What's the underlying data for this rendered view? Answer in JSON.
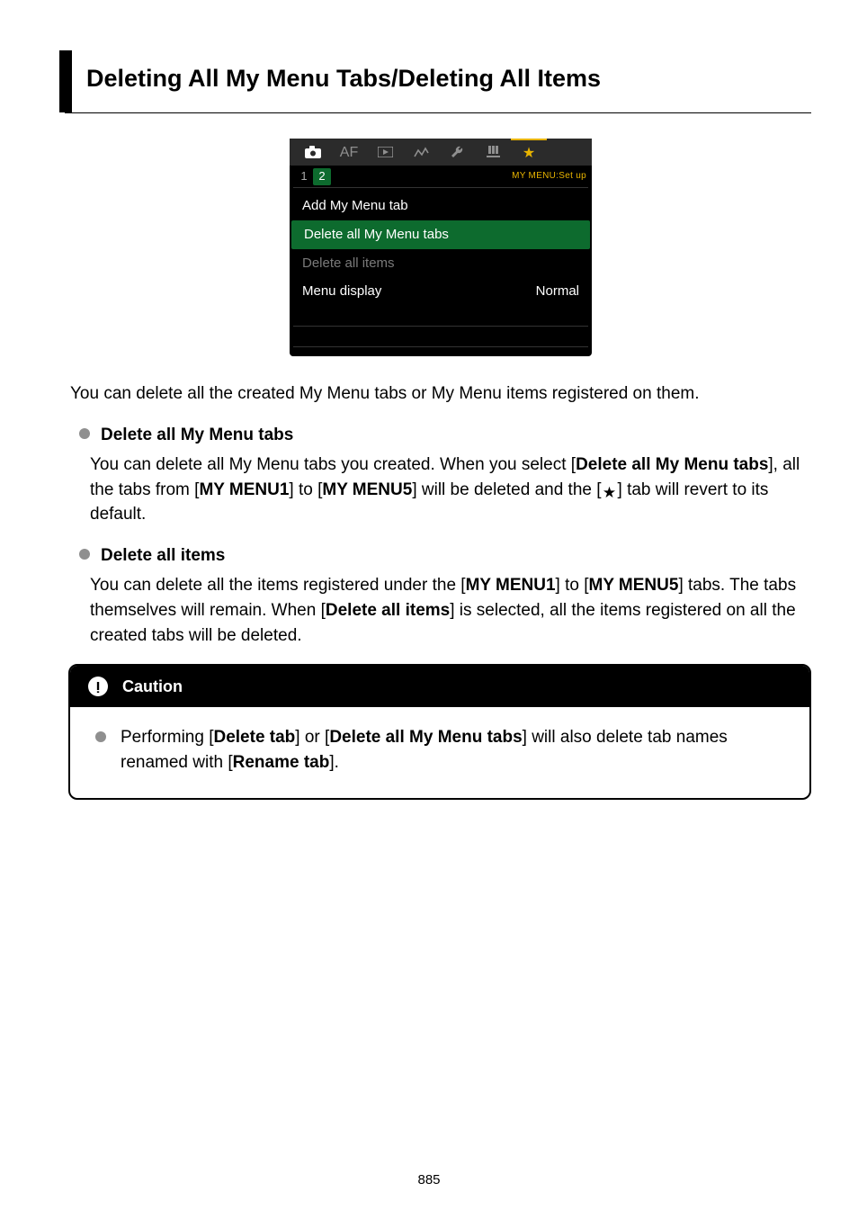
{
  "heading": "Deleting All My Menu Tabs/Deleting All Items",
  "menu": {
    "tabs": {
      "af_label": "AF",
      "sub1": "1",
      "sub2": "2",
      "sub_label": "MY MENU:Set up"
    },
    "items": {
      "add": "Add My Menu tab",
      "delete_tabs": "Delete all My Menu tabs",
      "delete_items": "Delete all items",
      "menu_display_label": "Menu display",
      "menu_display_value": "Normal"
    }
  },
  "intro": "You can delete all the created My Menu tabs or My Menu items registered on them.",
  "sections": {
    "tabs": {
      "title": "Delete all My Menu tabs",
      "p1": "You can delete all My Menu tabs you created. When you select [",
      "b1": "Delete all My Menu tabs",
      "p2": "], all the tabs from [",
      "b2": "MY MENU1",
      "p3": "] to [",
      "b3": "MY MENU5",
      "p4": "] will be deleted and the [",
      "p5": "] tab will revert to its default."
    },
    "items": {
      "title": "Delete all items",
      "p1": "You can delete all the items registered under the [",
      "b1": "MY MENU1",
      "p2": "] to [",
      "b2": "MY MENU5",
      "p3": "] tabs. The tabs themselves will remain. When [",
      "b3": "Delete all items",
      "p4": "] is selected, all the items registered on all the created tabs will be deleted."
    }
  },
  "caution": {
    "title": "Caution",
    "p1": "Performing [",
    "b1": "Delete tab",
    "p2": "] or [",
    "b2": "Delete all My Menu tabs",
    "p3": "] will also delete tab names renamed with [",
    "b3": "Rename tab",
    "p4": "]."
  },
  "page_number": "885"
}
